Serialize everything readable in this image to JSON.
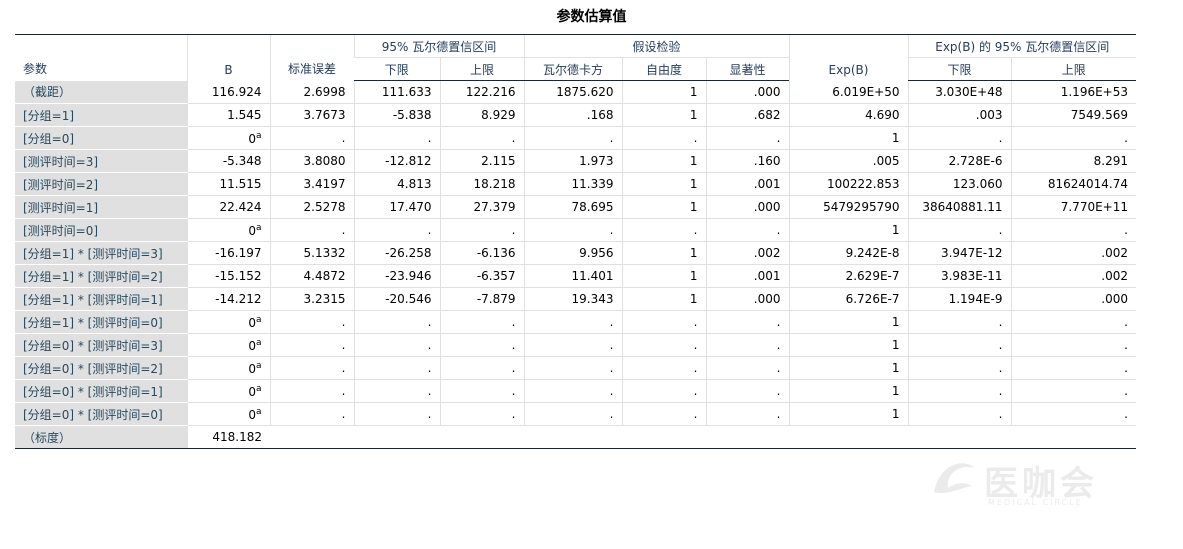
{
  "title": "参数估算值",
  "header": {
    "param": "参数",
    "b": "B",
    "std_err": "标准误差",
    "ci_group": "95% 瓦尔德置信区间",
    "ci_lower": "下限",
    "ci_upper": "上限",
    "test_group": "假设检验",
    "wald_chi": "瓦尔德卡方",
    "df": "自由度",
    "sig": "显著性",
    "expb": "Exp(B)",
    "expb_ci_group": "Exp(B) 的 95% 瓦尔德置信区间",
    "expb_lower": "下限",
    "expb_upper": "上限"
  },
  "superscript": "a",
  "rows": [
    {
      "param": "（截距）",
      "b": "116.924",
      "se": "2.6998",
      "lo": "111.633",
      "hi": "122.216",
      "wald": "1875.620",
      "df": "1",
      "sig": ".000",
      "expb": "6.019E+50",
      "elo": "3.030E+48",
      "ehi": "1.196E+53"
    },
    {
      "param": "[分组=1]",
      "b": "1.545",
      "se": "3.7673",
      "lo": "-5.838",
      "hi": "8.929",
      "wald": ".168",
      "df": "1",
      "sig": ".682",
      "expb": "4.690",
      "elo": ".003",
      "ehi": "7549.569"
    },
    {
      "param": "[分组=0]",
      "b": "0",
      "se": ".",
      "lo": ".",
      "hi": ".",
      "wald": ".",
      "df": ".",
      "sig": ".",
      "expb": "1",
      "elo": ".",
      "ehi": "."
    },
    {
      "param": "[测评时间=3]",
      "b": "-5.348",
      "se": "3.8080",
      "lo": "-12.812",
      "hi": "2.115",
      "wald": "1.973",
      "df": "1",
      "sig": ".160",
      "expb": ".005",
      "elo": "2.728E-6",
      "ehi": "8.291"
    },
    {
      "param": "[测评时间=2]",
      "b": "11.515",
      "se": "3.4197",
      "lo": "4.813",
      "hi": "18.218",
      "wald": "11.339",
      "df": "1",
      "sig": ".001",
      "expb": "100222.853",
      "elo": "123.060",
      "ehi": "81624014.74"
    },
    {
      "param": "[测评时间=1]",
      "b": "22.424",
      "se": "2.5278",
      "lo": "17.470",
      "hi": "27.379",
      "wald": "78.695",
      "df": "1",
      "sig": ".000",
      "expb": "5479295790",
      "elo": "38640881.11",
      "ehi": "7.770E+11"
    },
    {
      "param": "[测评时间=0]",
      "b": "0",
      "se": ".",
      "lo": ".",
      "hi": ".",
      "wald": ".",
      "df": ".",
      "sig": ".",
      "expb": "1",
      "elo": ".",
      "ehi": "."
    },
    {
      "param": "[分组=1] * [测评时间=3]",
      "b": "-16.197",
      "se": "5.1332",
      "lo": "-26.258",
      "hi": "-6.136",
      "wald": "9.956",
      "df": "1",
      "sig": ".002",
      "expb": "9.242E-8",
      "elo": "3.947E-12",
      "ehi": ".002"
    },
    {
      "param": "[分组=1] * [测评时间=2]",
      "b": "-15.152",
      "se": "4.4872",
      "lo": "-23.946",
      "hi": "-6.357",
      "wald": "11.401",
      "df": "1",
      "sig": ".001",
      "expb": "2.629E-7",
      "elo": "3.983E-11",
      "ehi": ".002"
    },
    {
      "param": "[分组=1] * [测评时间=1]",
      "b": "-14.212",
      "se": "3.2315",
      "lo": "-20.546",
      "hi": "-7.879",
      "wald": "19.343",
      "df": "1",
      "sig": ".000",
      "expb": "6.726E-7",
      "elo": "1.194E-9",
      "ehi": ".000"
    },
    {
      "param": "[分组=1] * [测评时间=0]",
      "b": "0",
      "se": ".",
      "lo": ".",
      "hi": ".",
      "wald": ".",
      "df": ".",
      "sig": ".",
      "expb": "1",
      "elo": ".",
      "ehi": "."
    },
    {
      "param": "[分组=0] * [测评时间=3]",
      "b": "0",
      "se": ".",
      "lo": ".",
      "hi": ".",
      "wald": ".",
      "df": ".",
      "sig": ".",
      "expb": "1",
      "elo": ".",
      "ehi": "."
    },
    {
      "param": "[分组=0] * [测评时间=2]",
      "b": "0",
      "se": ".",
      "lo": ".",
      "hi": ".",
      "wald": ".",
      "df": ".",
      "sig": ".",
      "expb": "1",
      "elo": ".",
      "ehi": "."
    },
    {
      "param": "[分组=0] * [测评时间=1]",
      "b": "0",
      "se": ".",
      "lo": ".",
      "hi": ".",
      "wald": ".",
      "df": ".",
      "sig": ".",
      "expb": "1",
      "elo": ".",
      "ehi": "."
    },
    {
      "param": "[分组=0] * [测评时间=0]",
      "b": "0",
      "se": ".",
      "lo": ".",
      "hi": ".",
      "wald": ".",
      "df": ".",
      "sig": ".",
      "expb": "1",
      "elo": ".",
      "ehi": "."
    },
    {
      "param": "（标度）",
      "b": "418.182",
      "se": "",
      "lo": "",
      "hi": "",
      "wald": "",
      "df": "",
      "sig": "",
      "expb": "",
      "elo": "",
      "ehi": ""
    }
  ],
  "watermark": {
    "text": "医咖会",
    "sub": "MEDICAL CIRCLE",
    "color": "#c7c7c7"
  },
  "colors": {
    "header_text": "#253d5b",
    "row_label_bg": "#e0e0e0",
    "row_label_text": "#264a60",
    "rule": "#152935"
  }
}
